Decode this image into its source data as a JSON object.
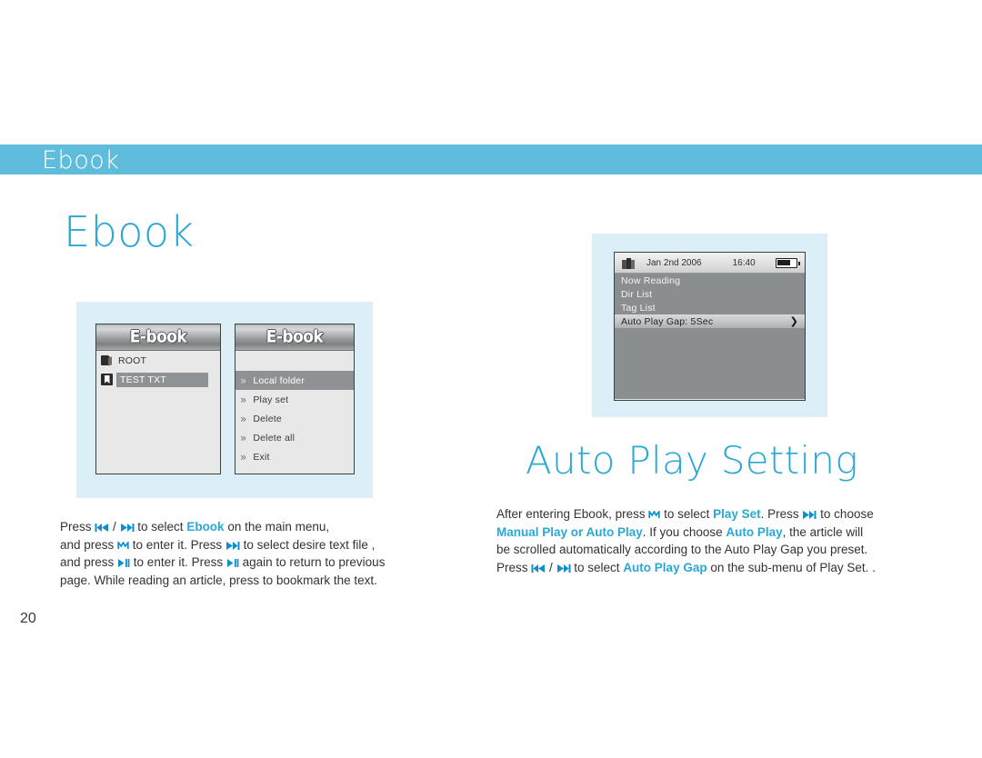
{
  "page": {
    "number": "20",
    "header_title": "Ebook",
    "section_title": "Ebook",
    "subsection_title": "Auto Play Setting",
    "accent_color": "#29a8d4",
    "header_bar_color": "#5fbcdb",
    "panel_color": "#dceef7"
  },
  "screens": {
    "file_list": {
      "title": "E-book",
      "rows": [
        {
          "icon": "folder-icon",
          "label": "ROOT",
          "selected": false
        },
        {
          "icon": "text-file-icon",
          "label": "TEST TXT",
          "selected": true
        }
      ]
    },
    "ebook_menu": {
      "title": "E-book",
      "items": [
        {
          "label": "Local folder",
          "selected": true
        },
        {
          "label": "Play set",
          "selected": false
        },
        {
          "label": "Delete",
          "selected": false
        },
        {
          "label": "Delete all",
          "selected": false
        },
        {
          "label": "Exit",
          "selected": false
        }
      ]
    },
    "play_set": {
      "status": {
        "icon": "books-icon",
        "date": "Jan 2nd 2006",
        "time": "16:40",
        "battery_icon": "battery-icon"
      },
      "items": [
        {
          "label": "Now Reading",
          "selected": false,
          "arrow": ""
        },
        {
          "label": "Dir List",
          "selected": false,
          "arrow": ""
        },
        {
          "label": "Tag List",
          "selected": false,
          "arrow": ""
        },
        {
          "label": "Auto Play Gap: 5Sec",
          "selected": true,
          "arrow": "❯"
        }
      ]
    }
  },
  "instructions": {
    "left": {
      "t1": "Press ",
      "sep": " / ",
      "t2": " to select ",
      "b1": "Ebook",
      "t3": " on the main menu,",
      "t4": "and press ",
      "t5": " to enter it. Press ",
      "t6": " to select desire text file ,",
      "t7": "and press ",
      "t8": " to enter it. Press ",
      "t9": " again to return to previous",
      "t10": "page. While reading an article, press to bookmark the text."
    },
    "right": {
      "t1": "After entering Ebook, press ",
      "t2": " to select ",
      "b1": "Play Set",
      "t3": ". Press ",
      "t4": " to choose",
      "b2": "Manual Play or Auto Play",
      "t5": ". If you choose ",
      "b3": "Auto Play",
      "t6": ", the article will",
      "t7": "be scrolled automatically according to the Auto Play Gap you preset.",
      "t8": "Press ",
      "sep": " / ",
      "t9": " to select ",
      "b4": "Auto Play Gap",
      "t10": " on the sub-menu of Play Set. ."
    }
  }
}
